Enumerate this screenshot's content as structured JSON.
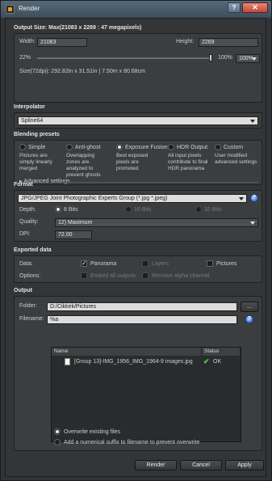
{
  "window": {
    "title": "Render",
    "help_label": "?",
    "close_label": "✕"
  },
  "output_size": {
    "title": "Output Size: Max(21083 x 2269 : 47 megapixels)",
    "width_label": "Width:",
    "width_value": "21083",
    "height_label": "Height:",
    "height_value": "2269",
    "scale_min": "22%",
    "scale_max": "100%",
    "scale_value": "100%",
    "scale_fraction": 1.0,
    "size_text": "Size(72dpi): 292.82in x 31.51in  |  7.50m x 80.68cm"
  },
  "interpolator": {
    "title": "Interpolator",
    "value": "Spline64"
  },
  "blending": {
    "title": "Blending presets",
    "options": [
      {
        "label": "Simple",
        "desc": "Pictures are simply linearly merged",
        "selected": false
      },
      {
        "label": "Anti-ghost",
        "desc": "Overlapping zones are analyzed to prevent ghosts",
        "selected": false
      },
      {
        "label": "Exposure Fusion",
        "desc": "Best exposed pixels are promoted",
        "selected": true
      },
      {
        "label": "HDR Output",
        "desc": "All input pixels contribute to final HDR panorama",
        "selected": false
      },
      {
        "label": "Custom",
        "desc": "User modified advanced settings",
        "selected": false
      }
    ],
    "advanced_label": "Advanced settings"
  },
  "format": {
    "title": "Format",
    "file_type": "JPG/JPEG Joint Photographic Experts Group (*.jpg *.jpeg)",
    "depth_label": "Depth:",
    "depth_options": [
      "8 Bits",
      "16 Bits",
      "32 Bits"
    ],
    "quality_label": "Quality:",
    "quality_value": "12) Maximum",
    "dpi_label": "DPI:",
    "dpi_value": "72.00"
  },
  "exported": {
    "title": "Exported data",
    "data_label": "Data:",
    "options_label": "Options:",
    "panorama": "Panorama",
    "layers": "Layers",
    "pictures": "Pictures",
    "embed": "Embed all outputs",
    "remove_alpha": "Remove alpha channel"
  },
  "output": {
    "title": "Output",
    "folder_label": "Folder:",
    "folder_value": "D:/Cikkek/Pictures",
    "browse_label": "...",
    "filename_label": "Filename:",
    "filename_value": "%a",
    "col_name": "Name",
    "col_status": "Status",
    "rows": [
      {
        "name": "[Group 13]-IMG_1956_IMG_1964-9 images.jpg",
        "status": "OK"
      }
    ],
    "overwrite_label": "Overwrite existing files",
    "suffix_label": "Add a numerical suffix to filename to prevent overwrite"
  },
  "buttons": {
    "render": "Render",
    "cancel": "Cancel",
    "apply": "Apply"
  }
}
